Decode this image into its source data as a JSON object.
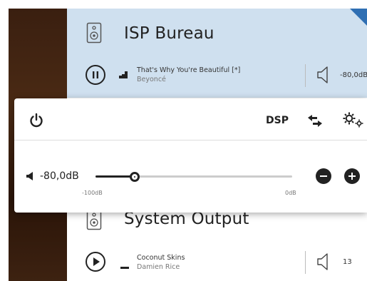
{
  "zones": [
    {
      "name": "ISP Bureau",
      "state": "paused",
      "track_title": "That's Why You're Beautiful [*]",
      "track_artist": "Beyoncé",
      "volume_text": "-80,0dB"
    },
    {
      "name": "System Output",
      "state": "stopped",
      "track_title": "Coconut Skins",
      "track_artist": "Damien Rice",
      "volume_text": "13"
    }
  ],
  "popup": {
    "dsp_label": "DSP",
    "volume_text": "-80,0dB",
    "volume_db": -80,
    "min_label": "-100dB",
    "max_label": "0dB",
    "min_db": -100,
    "max_db": 0
  },
  "colors": {
    "selected_zone": "#cfe0ef",
    "accent": "#2f6fb3"
  },
  "icons": [
    "speaker-icon",
    "pause-icon",
    "play-icon",
    "volume-icon",
    "power-icon",
    "transfer-icon",
    "settings-icon",
    "minus-icon",
    "plus-icon"
  ]
}
